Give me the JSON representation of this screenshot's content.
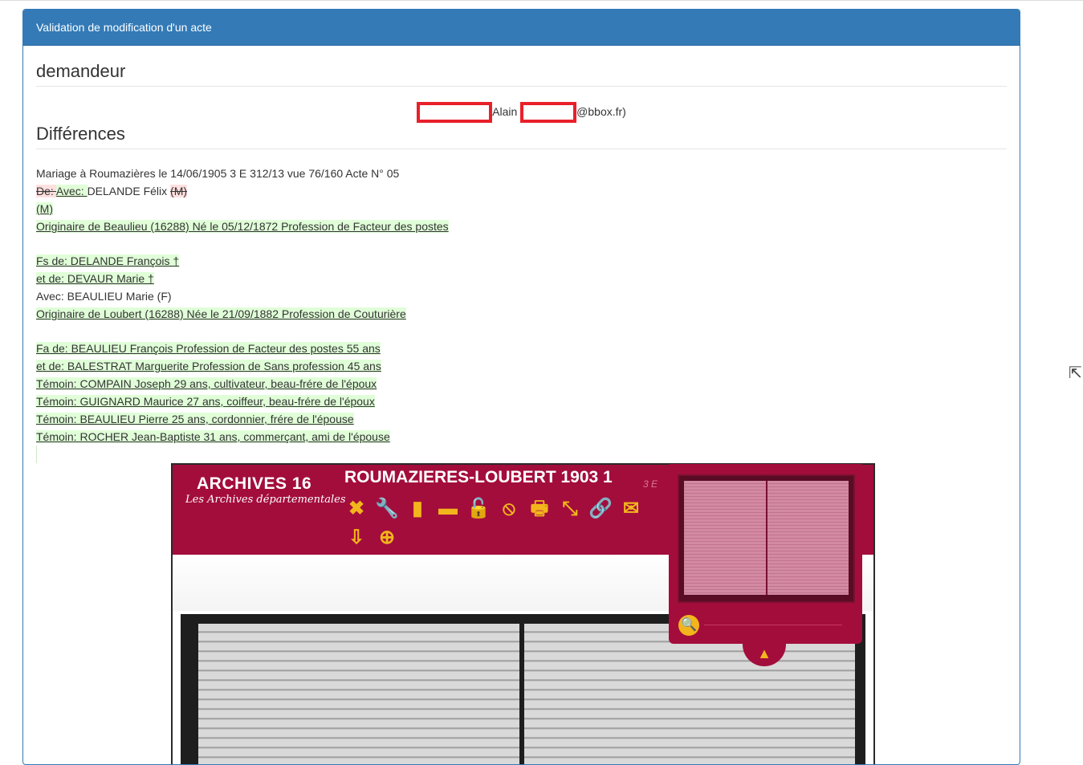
{
  "panel": {
    "heading": "Validation de modification d'un acte"
  },
  "requester": {
    "section_title": "demandeur",
    "name": "Alain",
    "email_suffix": "@bbox.fr)"
  },
  "differences": {
    "section_title": "Différences",
    "header_line": "Mariage à Roumazières le 14/06/1905 3 E 312/13 vue 76/160 Acte N° 05",
    "line2": {
      "deleted_prefix": "De: ",
      "inserted_prefix": "Avec: ",
      "text": "DELANDE Félix ",
      "deleted_suffix": "(M)"
    },
    "line3_inserted": "(M)",
    "line4_inserted": "Originaire de Beaulieu (16288) Né le 05/12/1872 Profession de Facteur des postes",
    "line5_inserted": "Fs de: DELANDE François †",
    "line6_inserted": "et de: DEVAUR Marie †",
    "line7": "Avec: BEAULIEU Marie (F)",
    "line8_inserted": "Originaire de Loubert (16288) Née le 21/09/1882 Profession de Couturière",
    "line9_inserted": "Fa de: BEAULIEU François Profession de Facteur des postes 55 ans",
    "line10_inserted": "et de: BALESTRAT Marguerite Profession de Sans profession 45 ans",
    "line11_inserted": "Témoin: COMPAIN Joseph 29 ans, cultivateur, beau-frére de l'époux",
    "line12_inserted": "Témoin: GUIGNARD Maurice 27 ans, coiffeur, beau-frére de l'époux",
    "line13_inserted": "Témoin: BEAULIEU Pierre 25 ans, cordonnier, frére de l'épouse",
    "line14_inserted": "Témoin: ROCHER Jean-Baptiste 31 ans, commerçant, ami de l'épouse"
  },
  "viewer": {
    "logo_main": "ARCHIVES 16",
    "logo_sub": "Les Archives départementales",
    "title": "ROUMAZIERES-LOUBERT 1903 1",
    "code": "3 E",
    "tools": [
      {
        "icon": "close-icon",
        "glyph": "✖"
      },
      {
        "icon": "wrench-icon",
        "glyph": "🔧"
      },
      {
        "icon": "vertical-split-icon",
        "glyph": "▮"
      },
      {
        "icon": "horizontal-split-icon",
        "glyph": "▬"
      },
      {
        "icon": "unlock-icon",
        "glyph": "🔓"
      },
      {
        "icon": "forbidden-icon",
        "glyph": "⦸"
      },
      {
        "icon": "print-icon",
        "glyph": "🖶"
      },
      {
        "icon": "resize-icon",
        "glyph": "⤡"
      },
      {
        "icon": "link-icon",
        "glyph": "🔗"
      },
      {
        "icon": "mail-icon",
        "glyph": "✉"
      },
      {
        "icon": "download-icon",
        "glyph": "⇩"
      },
      {
        "icon": "basket-add-icon",
        "glyph": "⊕"
      }
    ],
    "colors": {
      "bar": "#a30d3c",
      "icons": "#f3b51c"
    }
  }
}
